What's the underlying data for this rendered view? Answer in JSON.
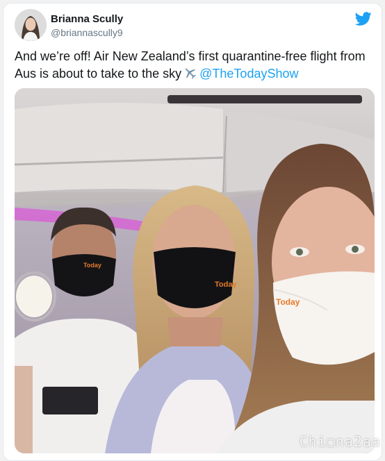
{
  "tweet": {
    "author": {
      "display_name": "Brianna Scully",
      "handle": "@briannascully9",
      "avatar_icon": "avatar-photo"
    },
    "text": "And we’re off! Air New Zealand’s first quarantine-free flight from Aus is about to take to the sky",
    "emoji_icon": "airplane-icon",
    "mention": "@TheTodayShow",
    "photo": {
      "description_icon": "selfie-photo",
      "mask_logo": "Today"
    }
  },
  "brand": {
    "twitter_icon": "twitter-bird-icon",
    "twitter_color": "#1da1f2"
  },
  "watermark": "Chi▢na2aa"
}
